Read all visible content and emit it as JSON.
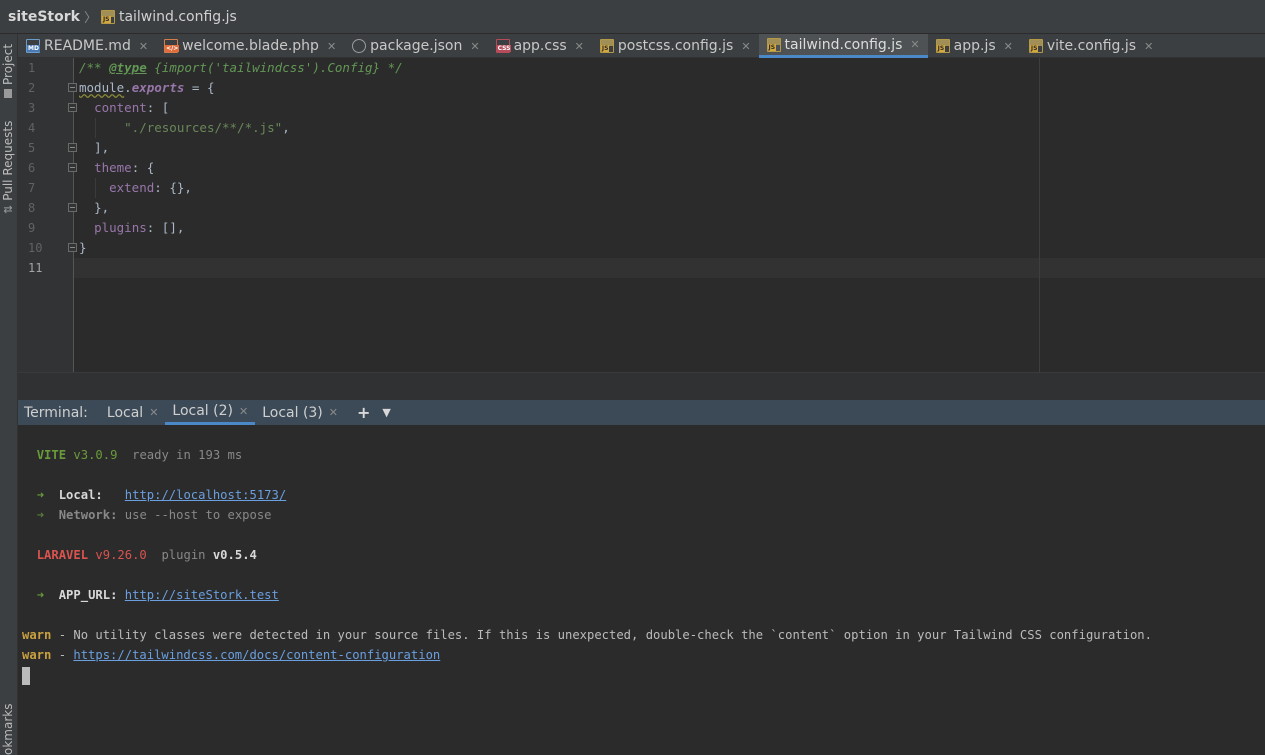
{
  "breadcrumb": {
    "project": "siteStork",
    "file": "tailwind.config.js"
  },
  "left_tools": {
    "project": "Project",
    "pull_requests": "Pull Requests",
    "bookmarks": "okmarks"
  },
  "tabs": [
    {
      "label": "README.md",
      "icon": "md-file-icon",
      "badge": "MD"
    },
    {
      "label": "welcome.blade.php",
      "icon": "php-file-icon",
      "badge": ""
    },
    {
      "label": "package.json",
      "icon": "json-file-icon",
      "badge": ""
    },
    {
      "label": "app.css",
      "icon": "css-file-icon",
      "badge": "CSS"
    },
    {
      "label": "postcss.config.js",
      "icon": "js-file-icon",
      "badge": "JS"
    },
    {
      "label": "tailwind.config.js",
      "icon": "js-file-icon",
      "badge": "JS",
      "active": true
    },
    {
      "label": "app.js",
      "icon": "js-file-icon",
      "badge": "JS"
    },
    {
      "label": "vite.config.js",
      "icon": "js-file-icon",
      "badge": "JS"
    }
  ],
  "editor": {
    "line_numbers": [
      "1",
      "2",
      "3",
      "4",
      "5",
      "6",
      "7",
      "8",
      "9",
      "10",
      "11"
    ],
    "code": {
      "l1_a": "/** ",
      "l1_tag": "@type",
      "l1_b": " {import('tailwindcss').Config} */",
      "l2_mod": "module",
      "l2_dot": ".",
      "l2_exp": "exports",
      "l2_rest": " = {",
      "l3_key": "content",
      "l3_rest": ": [",
      "l4_str": "\"./resources/**/*.js\"",
      "l4_rest": ",",
      "l5": "],",
      "l6_key": "theme",
      "l6_rest": ": {",
      "l7_key": "extend",
      "l7_rest": ": {},",
      "l8": "},",
      "l9_key": "plugins",
      "l9_rest": ": [],",
      "l10": "}"
    }
  },
  "terminal": {
    "label": "Terminal:",
    "tabs": [
      {
        "label": "Local"
      },
      {
        "label": "Local (2)",
        "active": true
      },
      {
        "label": "Local (3)"
      }
    ],
    "new_tab": "+",
    "lines": {
      "vite_name": "VITE",
      "vite_ver": "v3.0.9",
      "vite_ready": "ready in 193 ms",
      "arrow": "➜",
      "local_label": "Local:",
      "local_url": "http://localhost:5173/",
      "network_label": "Network:",
      "network_text": "use --host to expose",
      "laravel_name": "LARAVEL",
      "laravel_ver": "v9.26.0",
      "plugin_label": "plugin",
      "plugin_ver": "v0.5.4",
      "app_url_label": "APP_URL:",
      "app_url": "http://siteStork.test",
      "warn": "warn",
      "warn1_text": " - No utility classes were detected in your source files. If this is unexpected, double-check the `content` option in your Tailwind CSS configuration.",
      "warn2_dash": " - ",
      "warn2_url": "https://tailwindcss.com/docs/content-configuration"
    }
  }
}
